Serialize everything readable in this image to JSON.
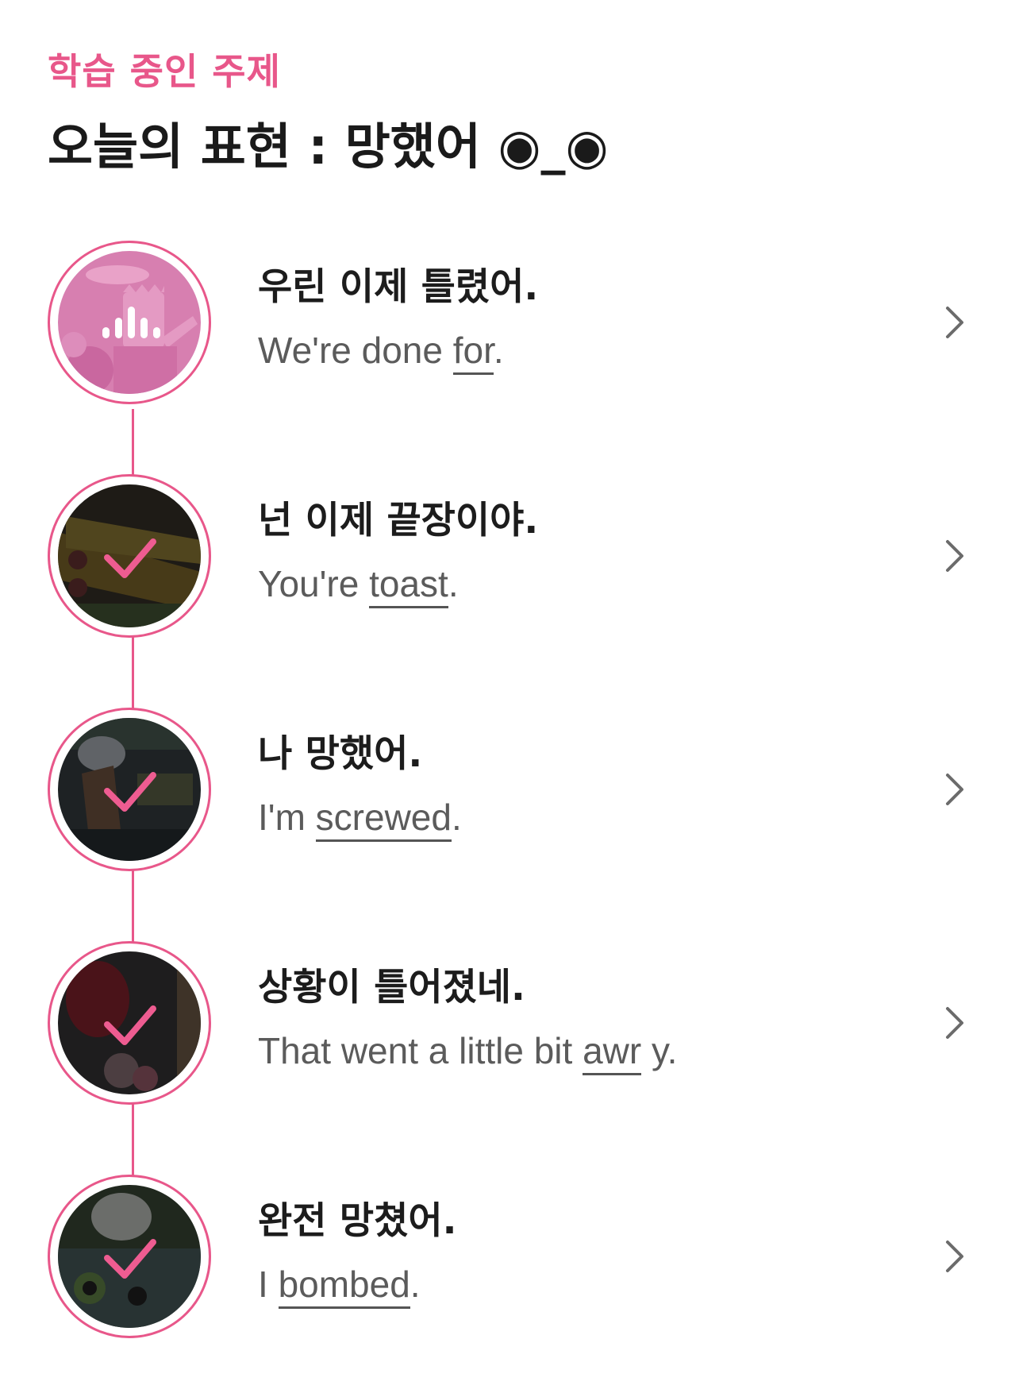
{
  "header": {
    "topic_label": "학습 중인 주제",
    "title": "오늘의 표현 : 망했어 ◉_◉"
  },
  "accent_color": "#e8578a",
  "lessons": [
    {
      "korean": "우린 이제 틀렸어.",
      "english_before": "We're done ",
      "keyword": "for",
      "english_after": ".",
      "status_icon": "audio-playing-icon",
      "completed": false
    },
    {
      "korean": "넌 이제 끝장이야.",
      "english_before": "You're ",
      "keyword": "toast",
      "english_after": ".",
      "status_icon": "checkmark-icon",
      "completed": true
    },
    {
      "korean": "나 망했어.",
      "english_before": "I'm ",
      "keyword": "screwed",
      "english_after": ".",
      "status_icon": "checkmark-icon",
      "completed": true
    },
    {
      "korean": "상황이 틀어졌네.",
      "english_before": "That went a little bit ",
      "keyword": "awr",
      "english_after": " y.",
      "status_icon": "checkmark-icon",
      "completed": true
    },
    {
      "korean": "완전 망쳤어.",
      "english_before": "I ",
      "keyword": "bombed",
      "english_after": ".",
      "status_icon": "checkmark-icon",
      "completed": true
    }
  ]
}
